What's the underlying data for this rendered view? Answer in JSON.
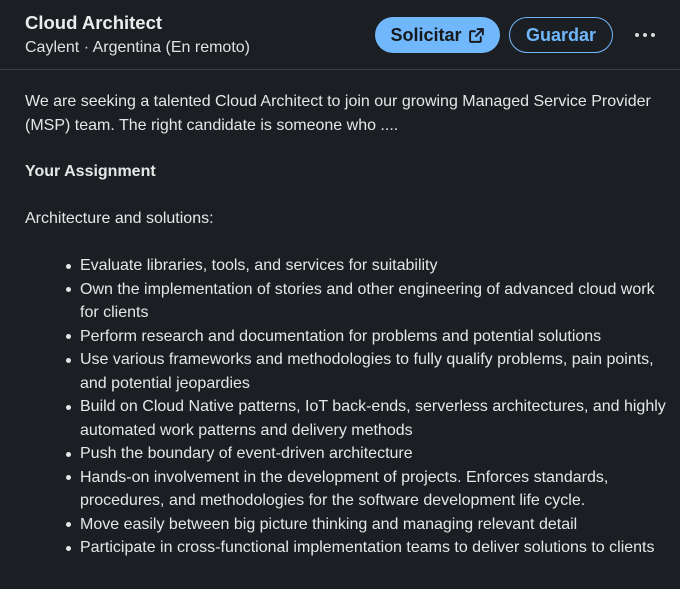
{
  "job": {
    "title": "Cloud Architect",
    "company_location": "Caylent · Argentina (En remoto)"
  },
  "actions": {
    "apply_label": "Solicitar",
    "apply_icon": "external-link-icon",
    "save_label": "Guardar",
    "more_icon": "more-horizontal-icon",
    "accent_color": "#71b7fb"
  },
  "description": {
    "intro": "We are seeking a talented Cloud Architect to join our growing Managed Service Provider (MSP) team. The right candidate is someone who ....",
    "section_heading": "Your Assignment",
    "sub_heading": "Architecture and solutions:",
    "bullets": [
      "Evaluate libraries, tools, and services for suitability",
      "Own the implementation of stories and other engineering of advanced cloud work for clients",
      "Perform research and documentation for problems and potential solutions",
      "Use various frameworks and methodologies to fully qualify problems, pain points, and potential jeopardies",
      "Build on Cloud Native patterns, IoT back-ends, serverless architectures, and highly automated work patterns and delivery methods",
      "Push the boundary of event-driven architecture",
      "Hands-on involvement in the development of projects. Enforces standards, procedures, and methodologies for the software development life cycle.",
      "Move easily between big picture thinking and managing relevant detail",
      "Participate in cross-functional implementation teams to deliver solutions to clients"
    ]
  }
}
